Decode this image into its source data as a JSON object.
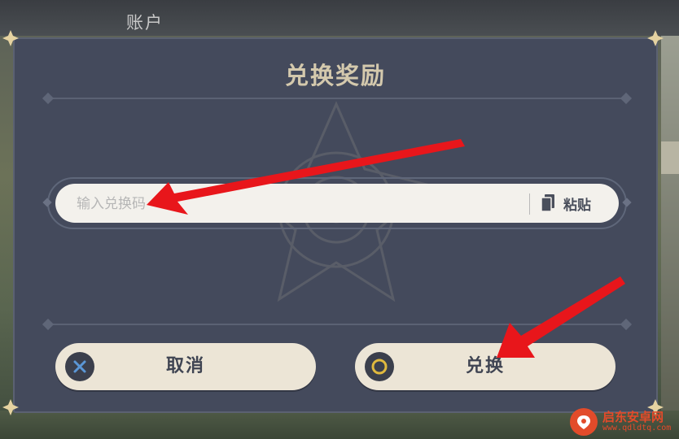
{
  "background": {
    "account_label": "账户"
  },
  "dialog": {
    "title": "兑换奖励",
    "code_input": {
      "placeholder": "输入兑换码",
      "value": ""
    },
    "paste_label": "粘贴",
    "cancel_label": "取消",
    "confirm_label": "兑换"
  },
  "watermark": {
    "title": "启东安卓网",
    "url": "www.qdldtq.com"
  },
  "colors": {
    "dialog_bg": "#444a5c",
    "title": "#d4c9ad",
    "button_bg": "#ece5d6",
    "arrow": "#e8161b",
    "cancel_icon": "#5b97d6",
    "confirm_icon": "#e0b93e"
  },
  "icons": [
    "corner-ornament-icon",
    "clipboard-icon",
    "cross-icon",
    "circle-icon",
    "red-arrow-icon",
    "watermark-logo-icon"
  ]
}
